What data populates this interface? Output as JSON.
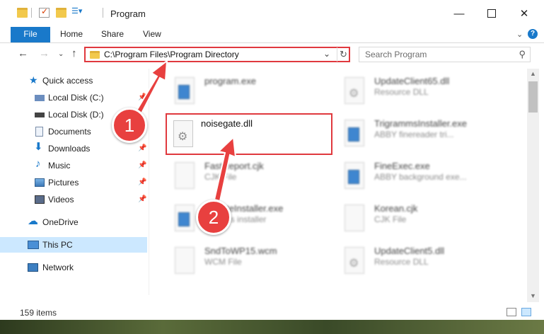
{
  "window": {
    "title": "Program",
    "minimize_icon": "minimize-icon",
    "maximize_icon": "maximize-icon",
    "close_icon": "close-icon"
  },
  "ribbon": {
    "tabs": [
      "File",
      "Home",
      "Share",
      "View"
    ]
  },
  "nav": {
    "address": "C:\\Program Files\\Program Directory",
    "search_placeholder": "Search Program"
  },
  "sidebar": {
    "items": [
      {
        "label": "Quick access",
        "icon": "star-icon"
      },
      {
        "label": "Local Disk (C:)",
        "icon": "drive-icon"
      },
      {
        "label": "Local Disk (D:)",
        "icon": "drive-icon"
      },
      {
        "label": "Documents",
        "icon": "documents-icon"
      },
      {
        "label": "Downloads",
        "icon": "download-icon"
      },
      {
        "label": "Music",
        "icon": "music-icon"
      },
      {
        "label": "Pictures",
        "icon": "pictures-icon"
      },
      {
        "label": "Videos",
        "icon": "videos-icon"
      },
      {
        "label": "OneDrive",
        "icon": "cloud-icon"
      },
      {
        "label": "This PC",
        "icon": "computer-icon"
      },
      {
        "label": "Network",
        "icon": "network-icon"
      }
    ]
  },
  "files": [
    {
      "name": "program.exe",
      "desc": ""
    },
    {
      "name": "UpdateClient65.dll",
      "desc": "Resource DLL"
    },
    {
      "name": "noisegate.dll",
      "desc": ""
    },
    {
      "name": "TrigrammsInstaller.exe",
      "desc": "ABBY finereader tri..."
    },
    {
      "name": "FastReport.cjk",
      "desc": "CJK File"
    },
    {
      "name": "FineExec.exe",
      "desc": "ABBY background exe..."
    },
    {
      "name": "UpdateInstaller.exe",
      "desc": "updates installer"
    },
    {
      "name": "Korean.cjk",
      "desc": "CJK File"
    },
    {
      "name": "SndToWP15.wcm",
      "desc": "WCM File"
    },
    {
      "name": "UpdateClient5.dll",
      "desc": "Resource DLL"
    }
  ],
  "status": {
    "count": "159 items"
  },
  "annotations": {
    "step1": "1",
    "step2": "2",
    "color": "#e8403f"
  }
}
